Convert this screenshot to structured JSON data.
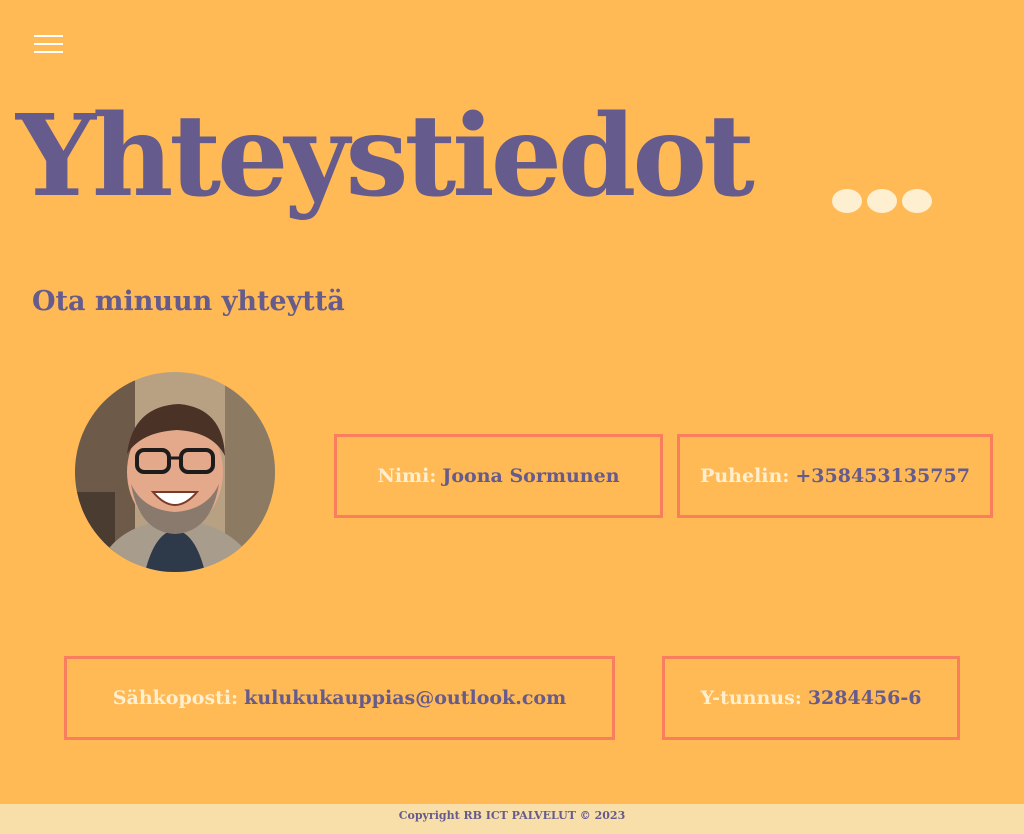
{
  "menu": {
    "icon": "hamburger-menu-icon"
  },
  "hero": {
    "title": "Yhteystiedot"
  },
  "contact": {
    "heading": "Ota minuun yhteyttä",
    "name_label": "Nimi:",
    "name_value": "Joona Sormunen",
    "phone_label": "Puhelin:",
    "phone_value": "+358453135757",
    "email_label": "Sähkoposti:",
    "email_value": "kulukukauppias@outlook.com",
    "ytunnus_label": "Y-tunnus:",
    "ytunnus_value": "3284456-6"
  },
  "footer": {
    "text": "Copyright RB ICT PALVELUT © 2023"
  },
  "colors": {
    "background": "#FFB955",
    "primary_text": "#655B8C",
    "label_text": "#FDEFD0",
    "box_border": "#F97E5E",
    "footer_bg": "#F8DFAA"
  }
}
